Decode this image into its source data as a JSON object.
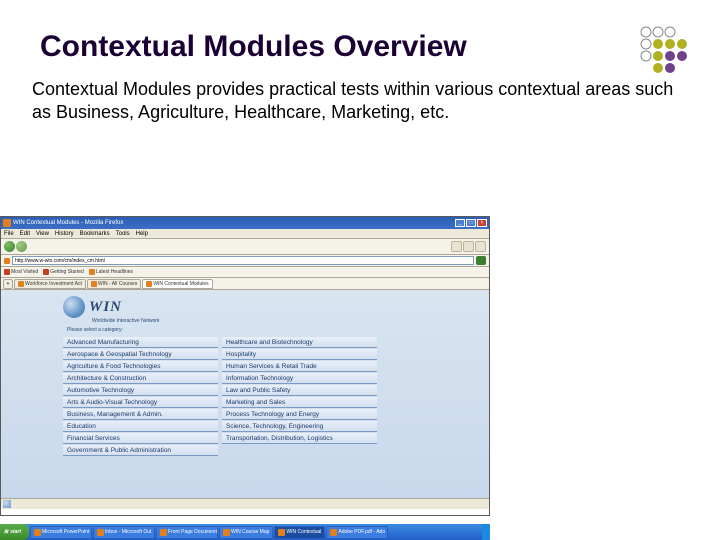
{
  "slide": {
    "title": "Contextual Modules Overview",
    "body": "Contextual Modules provides practical tests within various contextual areas such as Business, Agriculture, Healthcare, Marketing, etc."
  },
  "browser": {
    "window_title": "WIN Contextual Modules - Mozilla Firefox",
    "menus": [
      "File",
      "Edit",
      "View",
      "History",
      "Bookmarks",
      "Tools",
      "Help"
    ],
    "url": "http://www.w-win.com/cm/index_cm.html",
    "links_label": "Most Visited",
    "link1": "Getting Started",
    "link2": "Latest Headlines",
    "tabs": [
      {
        "label": "Workforce Investment Act"
      },
      {
        "label": "WIN - All Courses"
      },
      {
        "label": "WIN Contextual Modules"
      }
    ]
  },
  "content": {
    "brand": "WIN",
    "brand_sub": "Worldwide Interactive Network",
    "prompt": "Please select a category:",
    "col1": [
      "Advanced Manufacturing",
      "Aerospace & Geospatial Technology",
      "Agriculture & Food Technologies",
      "Architecture & Construction",
      "Automotive Technology",
      "Arts & Audio-Visual Technology",
      "Business, Management & Admin.",
      "Education",
      "Financial Services",
      "Government & Public Administration"
    ],
    "col2": [
      "Healthcare and Biotechnology",
      "Hospitality",
      "Human Services & Retail Trade",
      "Information Technology",
      "Law and Public Safety",
      "Marketing and Sales",
      "Process Technology and Energy",
      "Science, Technology, Engineering",
      "Transportation, Distribution, Logistics"
    ]
  },
  "taskbar": {
    "start": "start",
    "items": [
      "Microsoft PowerPoint",
      "Inbox - Microsoft Out",
      "Front Page Document",
      "WIN Course Map",
      "WIN Contextual",
      "Adobe PDF.pdf - Ado"
    ]
  }
}
